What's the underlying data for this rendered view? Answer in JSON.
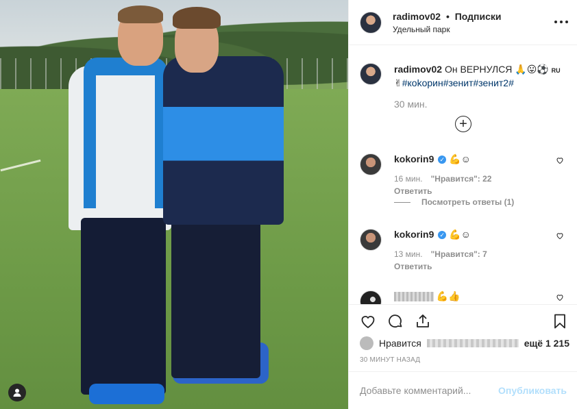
{
  "post": {
    "author": "radimov02",
    "separator": "•",
    "follow_state": "Подписки",
    "location": "Удельный парк"
  },
  "caption": {
    "author": "radimov02",
    "text_part1": "Он ВЕРНУЛСЯ 🙏😛⚽",
    "flag": "RU",
    "text_part2": "✌",
    "hashtags": "#коkoрин#зенит#зенит2#",
    "time": "30 мин."
  },
  "load_more_label": "+",
  "comments": [
    {
      "author": "kokorin9",
      "verified": "✓",
      "text": "💪☺",
      "time": "16 мин.",
      "likes": "\"Нравится\": 22",
      "reply": "Ответить",
      "view_replies": "Посмотреть ответы (1)"
    },
    {
      "author": "kokorin9",
      "verified": "✓",
      "text": "💪☺",
      "time": "13 мин.",
      "likes": "\"Нравится\": 7",
      "reply": "Ответить"
    },
    {
      "author": "",
      "text": "💪👍"
    }
  ],
  "likes": {
    "label": "Нравится",
    "more": "ещё 1 215"
  },
  "timestamp": "30 минут назад",
  "add_comment": {
    "placeholder": "Добавьте комментарий...",
    "publish": "Опубликовать"
  },
  "icons": {
    "like": "heart-icon",
    "comment": "comment-icon",
    "share": "share-icon",
    "save": "bookmark-icon",
    "more": "more-dots-icon",
    "user_tag": "user-tag-icon"
  },
  "colors": {
    "hashtag": "#00376b",
    "verified": "#3897f0",
    "publish_disabled": "#b2dffc",
    "muted": "#8e8e8e"
  }
}
